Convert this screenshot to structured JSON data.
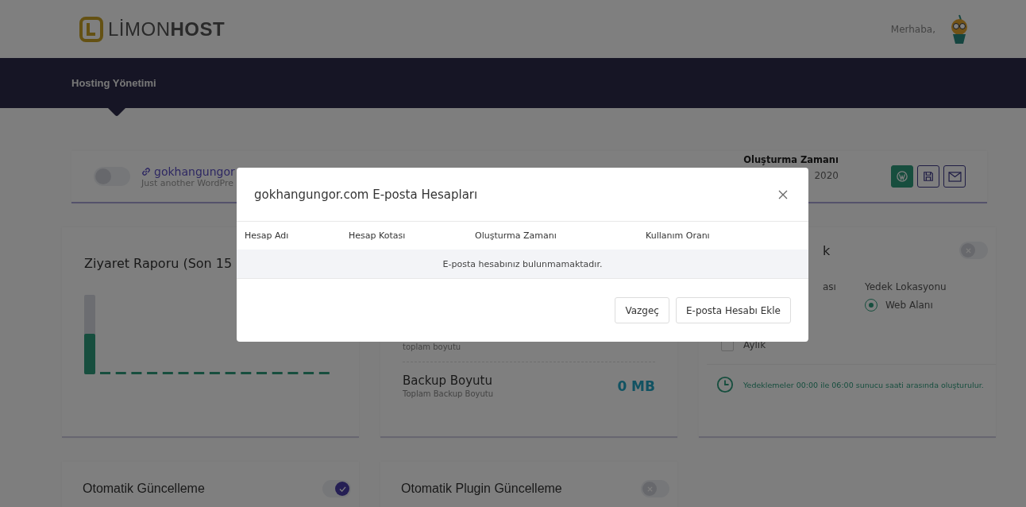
{
  "header": {
    "logo_light": "LİMON",
    "logo_bold": "HOST",
    "greeting": "Merhaba,"
  },
  "nav": {
    "items": [
      {
        "label": "Hosting Yönetimi",
        "selected": true
      }
    ]
  },
  "site": {
    "enabled": false,
    "domain": "gokhangungor",
    "tagline": "Just another WordPre",
    "created_label": "Oluşturma Zamanı",
    "created_value": "2020"
  },
  "visit_report": {
    "title": "Ziyaret Raporu (Son 15"
  },
  "sizes": {
    "first_description": "toplam boyutu",
    "title": "Backup Boyutu",
    "description": "Toplam Backup Boyutu",
    "value": "0 MB"
  },
  "backup": {
    "title": "k",
    "enabled": false,
    "frequency_label": "ası",
    "location_label": "Yedek Lokasyonu",
    "locations": [
      {
        "label": "Web Alanı",
        "selected": true
      }
    ],
    "periods": [
      {
        "label": "Aylık",
        "checked": false
      }
    ],
    "note": "Yedeklemeler 00:00 ile 06:00 sunucu saati arasında oluşturulur."
  },
  "updates": [
    {
      "title": "Otomatik Güncelleme",
      "on": true
    },
    {
      "title": "Otomatik Plugin Güncelleme",
      "on": false
    }
  ],
  "modal": {
    "title": "gokhangungor.com E-posta Hesapları",
    "columns": [
      "Hesap Adı",
      "Hesap Kotası",
      "Oluşturma Zamanı",
      "Kullanım Oranı"
    ],
    "empty_message": "E-posta hesabınız bulunmamaktadır.",
    "buttons": [
      {
        "label": "Vazgeç"
      },
      {
        "label": "E-posta Hesabı Ekle"
      }
    ]
  }
}
